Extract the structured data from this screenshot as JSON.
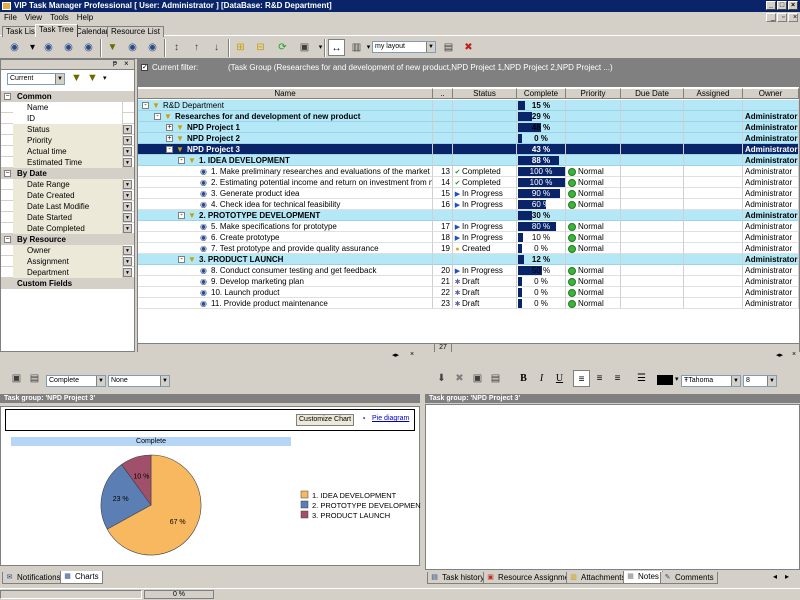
{
  "window": {
    "title": "VIP Task Manager Professional [ User: Administrator ] [DataBase: R&D Department]"
  },
  "menu": [
    "File",
    "View",
    "Tools",
    "Help"
  ],
  "tabs": [
    "Task List",
    "Task Tree",
    "Calendar",
    "Resource List"
  ],
  "toolbar": {
    "layout_value": "my layout"
  },
  "filter_panel": {
    "view_value": "Current",
    "sections": [
      {
        "title": "Common",
        "fields": [
          "Name",
          "ID",
          "Status",
          "Priority",
          "Actual time",
          "Estimated Time"
        ]
      },
      {
        "title": "By Date",
        "fields": [
          "Date Range",
          "Date Created",
          "Date Last Modifie",
          "Date Started",
          "Date Completed"
        ]
      },
      {
        "title": "By Resource",
        "fields": [
          "Owner",
          "Assignment",
          "Department"
        ]
      }
    ],
    "custom_fields": "Custom Fields"
  },
  "grid": {
    "filter_label": "Current filter:",
    "filter_text": "(Task Group  (Researches for and development of new product,NPD Project 1,NPD Project 2,NPD Project ...)",
    "columns": [
      "Name",
      "..",
      "Status",
      "Complete",
      "Priority",
      "Due Date",
      "Assigned",
      "Owner"
    ],
    "rows": [
      {
        "name": "R&D Department",
        "id": "",
        "status": "",
        "complete": 15,
        "complete_label": "15 %",
        "priority": "",
        "owner": "",
        "kind": "root",
        "level": 0,
        "exp": "-"
      },
      {
        "name": "Researches for and development of new product",
        "id": "",
        "status": "",
        "complete": 29,
        "complete_label": "29 %",
        "priority": "",
        "owner": "Administrator",
        "kind": "group",
        "level": 1,
        "exp": "-"
      },
      {
        "name": "NPD Project 1",
        "id": "",
        "status": "",
        "complete": 48,
        "complete_label": "48 %",
        "priority": "",
        "owner": "Administrator",
        "kind": "group",
        "level": 2,
        "exp": "+"
      },
      {
        "name": "NPD Project 2",
        "id": "",
        "status": "",
        "complete": 0,
        "complete_label": "0 %",
        "priority": "",
        "owner": "Administrator",
        "kind": "group",
        "level": 2,
        "exp": "+"
      },
      {
        "name": "NPD Project 3",
        "id": "",
        "status": "",
        "complete": 43,
        "complete_label": "43 %",
        "priority": "",
        "owner": "Administrator",
        "kind": "sel",
        "level": 2,
        "exp": "-"
      },
      {
        "name": "1. IDEA DEVELOPMENT",
        "id": "",
        "status": "",
        "complete": 88,
        "complete_label": "88 %",
        "priority": "",
        "owner": "Administrator",
        "kind": "group",
        "level": 3,
        "exp": "-"
      },
      {
        "name": "1. Make preliminary researches and evaluations of the market demand",
        "id": "13",
        "status": "Completed",
        "complete": 100,
        "complete_label": "100 %",
        "priority": "Normal",
        "owner": "Administrator",
        "kind": "task",
        "level": 4
      },
      {
        "name": "2. Estimating potential income and return on investment from new idea",
        "id": "14",
        "status": "Completed",
        "complete": 100,
        "complete_label": "100 %",
        "priority": "Normal",
        "owner": "Administrator",
        "kind": "task",
        "level": 4
      },
      {
        "name": "3. Generate product idea",
        "id": "15",
        "status": "In Progress",
        "complete": 90,
        "complete_label": "90 %",
        "priority": "Normal",
        "owner": "Administrator",
        "kind": "task",
        "level": 4
      },
      {
        "name": "4. Check idea for technical feasibility",
        "id": "16",
        "status": "In Progress",
        "complete": 60,
        "complete_label": "60 %",
        "priority": "Normal",
        "owner": "Administrator",
        "kind": "task",
        "level": 4
      },
      {
        "name": "2. PROTOTYPE DEVELOPMENT",
        "id": "",
        "status": "",
        "complete": 30,
        "complete_label": "30 %",
        "priority": "",
        "owner": "Administrator",
        "kind": "group",
        "level": 3,
        "exp": "-"
      },
      {
        "name": "5. Make specifications for prototype",
        "id": "17",
        "status": "In Progress",
        "complete": 80,
        "complete_label": "80 %",
        "priority": "Normal",
        "owner": "Administrator",
        "kind": "task",
        "level": 4
      },
      {
        "name": "6. Create prototype",
        "id": "18",
        "status": "In Progress",
        "complete": 10,
        "complete_label": "10 %",
        "priority": "Normal",
        "owner": "Administrator",
        "kind": "task",
        "level": 4
      },
      {
        "name": "7. Test prototype and provide quality assurance",
        "id": "19",
        "status": "Created",
        "complete": 0,
        "complete_label": "0 %",
        "priority": "Normal",
        "owner": "Administrator",
        "kind": "task",
        "level": 4
      },
      {
        "name": "3. PRODUCT LAUNCH",
        "id": "",
        "status": "",
        "complete": 12,
        "complete_label": "12 %",
        "priority": "",
        "owner": "Administrator",
        "kind": "group",
        "level": 3,
        "exp": "-"
      },
      {
        "name": "8. Conduct consumer testing and get feedback",
        "id": "20",
        "status": "In Progress",
        "complete": 50,
        "complete_label": "50 %",
        "priority": "Normal",
        "owner": "Administrator",
        "kind": "task",
        "level": 4
      },
      {
        "name": "9. Develop marketing plan",
        "id": "21",
        "status": "Draft",
        "complete": 0,
        "complete_label": "0 %",
        "priority": "Normal",
        "owner": "Administrator",
        "kind": "task",
        "level": 4
      },
      {
        "name": "10. Launch product",
        "id": "22",
        "status": "Draft",
        "complete": 0,
        "complete_label": "0 %",
        "priority": "Normal",
        "owner": "Administrator",
        "kind": "task",
        "level": 4
      },
      {
        "name": "11. Provide product maintenance",
        "id": "23",
        "status": "Draft",
        "complete": 0,
        "complete_label": "0 %",
        "priority": "Normal",
        "owner": "Administrator",
        "kind": "task",
        "level": 4
      }
    ],
    "footer_count": "27"
  },
  "charts_panel": {
    "combo1": "Complete",
    "combo2": "None",
    "title": "Task group: 'NPD Project 3'",
    "customize_label": "Customize Chart",
    "pie_link": "Pie diagram"
  },
  "chart_data": {
    "type": "pie",
    "title": "Complete",
    "slices": [
      {
        "name": "1. IDEA DEVELOPMENT",
        "value": 67,
        "label": "67 %",
        "color": "#f8b860"
      },
      {
        "name": "2. PROTOTYPE DEVELOPMENT",
        "value": 23,
        "label": "23 %",
        "color": "#5b7fb5"
      },
      {
        "name": "3. PRODUCT LAUNCH",
        "value": 10,
        "label": "10 %",
        "color": "#a0506a"
      }
    ],
    "legend_position": "right"
  },
  "notes_panel": {
    "title": "Task group: 'NPD Project 3'",
    "font": "Tahoma",
    "size": "8"
  },
  "bottom_tabs_left": [
    "Notifications",
    "Charts"
  ],
  "bottom_tabs_right": [
    "Task history",
    "Resource Assignment",
    "Attachments",
    "Notes",
    "Comments"
  ],
  "status": {
    "progress": "0 %"
  }
}
